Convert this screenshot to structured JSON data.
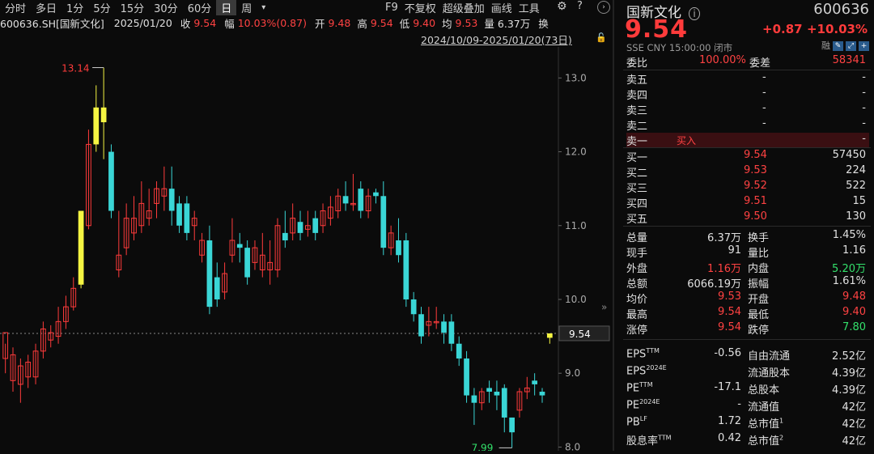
{
  "toolbar": {
    "timeframes": [
      "分时",
      "多日",
      "1分",
      "5分",
      "15分",
      "30分",
      "60分",
      "日",
      "周"
    ],
    "active": "日",
    "dropdown": "▾",
    "tools": [
      "F9",
      "不复权",
      "超级叠加",
      "画线",
      "工具"
    ]
  },
  "info": {
    "ticker": "600636.SH[国新文化]",
    "date": "2025/01/20",
    "close_l": "收",
    "close": "9.54",
    "chg_l": "幅",
    "chg": "10.03%(0.87)",
    "open_l": "开",
    "open": "9.48",
    "high_l": "高",
    "high": "9.54",
    "low_l": "低",
    "low": "9.40",
    "avg_l": "均",
    "avg": "9.53",
    "vol_l": "量",
    "vol": "6.37万",
    "switch": "换"
  },
  "range_label": "2024/10/09-2025/01/20(73日)",
  "chart_data": {
    "type": "candlestick",
    "y_ticks": [
      "13.0",
      "12.0",
      "11.0",
      "10.0",
      "9.0",
      "8.0"
    ],
    "ylim": [
      7.95,
      13.42
    ],
    "current_price": "9.54",
    "max_label": "13.14",
    "min_label": "7.99",
    "candles": [
      [
        9.2,
        9.55,
        9.4,
        9.0
      ],
      [
        8.9,
        9.25,
        9.35,
        8.75
      ],
      [
        8.85,
        9.1,
        9.2,
        8.6
      ],
      [
        8.95,
        9.15,
        9.25,
        8.8
      ],
      [
        8.95,
        9.3,
        9.4,
        8.85
      ],
      [
        9.3,
        9.6,
        9.7,
        9.2
      ],
      [
        9.45,
        9.55,
        9.65,
        9.35
      ],
      [
        9.5,
        9.7,
        9.9,
        9.4
      ],
      [
        9.7,
        9.9,
        10.05,
        9.6
      ],
      [
        9.9,
        10.15,
        10.3,
        9.85
      ],
      [
        10.2,
        11.2,
        11.2,
        10.15
      ],
      [
        11.0,
        12.1,
        12.3,
        10.95
      ],
      [
        12.1,
        12.6,
        12.9,
        12.0
      ],
      [
        12.4,
        12.6,
        13.14,
        11.9
      ],
      [
        12.0,
        11.2,
        12.1,
        11.1
      ],
      [
        10.4,
        10.6,
        11.2,
        10.3
      ],
      [
        10.7,
        11.1,
        11.3,
        10.6
      ],
      [
        10.9,
        11.1,
        11.4,
        10.8
      ],
      [
        11.0,
        11.3,
        11.6,
        10.9
      ],
      [
        11.1,
        11.2,
        11.5,
        11.0
      ],
      [
        11.3,
        11.5,
        11.6,
        11.1
      ],
      [
        11.4,
        11.5,
        11.8,
        11.2
      ],
      [
        11.5,
        11.2,
        11.8,
        11.0
      ],
      [
        11.3,
        11.0,
        11.4,
        10.9
      ],
      [
        11.3,
        10.9,
        11.4,
        10.8
      ],
      [
        11.0,
        11.1,
        11.2,
        10.8
      ],
      [
        10.6,
        10.8,
        10.9,
        10.5
      ],
      [
        10.8,
        9.9,
        11.0,
        9.8
      ],
      [
        10.3,
        10.0,
        10.5,
        9.9
      ],
      [
        10.1,
        10.35,
        10.5,
        10.0
      ],
      [
        10.6,
        10.8,
        11.1,
        10.5
      ],
      [
        10.75,
        10.7,
        10.9,
        10.5
      ],
      [
        10.7,
        10.3,
        10.8,
        10.2
      ],
      [
        10.5,
        10.7,
        10.8,
        10.4
      ],
      [
        10.4,
        10.6,
        10.9,
        10.3
      ],
      [
        10.4,
        10.5,
        10.8,
        10.2
      ],
      [
        10.4,
        11.0,
        11.1,
        10.3
      ],
      [
        10.9,
        10.8,
        11.2,
        10.7
      ],
      [
        10.9,
        11.1,
        11.3,
        10.8
      ],
      [
        11.05,
        10.9,
        11.2,
        10.8
      ],
      [
        10.95,
        11.0,
        11.2,
        10.85
      ],
      [
        11.1,
        10.9,
        11.2,
        10.8
      ],
      [
        11.0,
        11.2,
        11.3,
        10.9
      ],
      [
        11.1,
        11.25,
        11.4,
        11.0
      ],
      [
        11.2,
        11.4,
        11.5,
        11.1
      ],
      [
        11.4,
        11.3,
        11.6,
        11.2
      ],
      [
        11.3,
        11.3,
        11.7,
        11.2
      ],
      [
        11.5,
        11.2,
        11.6,
        11.1
      ],
      [
        11.2,
        11.4,
        11.5,
        11.1
      ],
      [
        11.45,
        11.4,
        11.5,
        11.3
      ],
      [
        11.4,
        10.7,
        11.6,
        10.6
      ],
      [
        10.7,
        10.9,
        11.0,
        10.6
      ],
      [
        10.8,
        10.6,
        11.1,
        10.5
      ],
      [
        10.8,
        10.0,
        10.9,
        9.9
      ],
      [
        10.0,
        9.8,
        10.1,
        9.7
      ],
      [
        9.8,
        9.5,
        9.9,
        9.4
      ],
      [
        9.65,
        9.7,
        9.9,
        9.5
      ],
      [
        9.7,
        9.7,
        9.9,
        9.6
      ],
      [
        9.7,
        9.55,
        9.8,
        9.4
      ],
      [
        9.7,
        9.4,
        9.8,
        9.3
      ],
      [
        9.4,
        9.2,
        9.5,
        9.1
      ],
      [
        9.2,
        8.7,
        9.3,
        8.6
      ],
      [
        8.7,
        8.6,
        8.8,
        8.3
      ],
      [
        8.6,
        8.75,
        8.8,
        8.5
      ],
      [
        8.8,
        8.75,
        8.9,
        8.6
      ],
      [
        8.75,
        8.7,
        8.9,
        8.5
      ],
      [
        8.8,
        8.4,
        8.85,
        8.2
      ],
      [
        8.4,
        8.2,
        8.4,
        7.99
      ],
      [
        8.5,
        8.75,
        8.8,
        8.4
      ],
      [
        8.75,
        8.8,
        8.95,
        8.65
      ],
      [
        8.9,
        8.85,
        9.0,
        8.7
      ],
      [
        8.75,
        8.7,
        8.8,
        8.6
      ],
      [
        9.48,
        9.54,
        9.54,
        9.4
      ]
    ],
    "limit_up_days": [
      10,
      12,
      13,
      72
    ]
  },
  "panel": {
    "name": "国新文化",
    "code": "600636",
    "price": "9.54",
    "change": "+0.87",
    "pct": "+10.03%",
    "sub": "SSE  CNY  15:00:00  闭市",
    "rz": "融",
    "weibi_l": "委比",
    "weibi": "100.00%",
    "weicha_l": "委差",
    "weicha": "58341",
    "sells": [
      {
        "l": "卖五",
        "p": "-",
        "v": "-"
      },
      {
        "l": "卖四",
        "p": "-",
        "v": "-"
      },
      {
        "l": "卖三",
        "p": "-",
        "v": "-"
      },
      {
        "l": "卖二",
        "p": "-",
        "v": "-"
      },
      {
        "l": "卖一",
        "p": "买入",
        "v": "-"
      }
    ],
    "buys": [
      {
        "l": "买一",
        "p": "9.54",
        "v": "57450"
      },
      {
        "l": "买二",
        "p": "9.53",
        "v": "224"
      },
      {
        "l": "买三",
        "p": "9.52",
        "v": "522"
      },
      {
        "l": "买四",
        "p": "9.51",
        "v": "15"
      },
      {
        "l": "买五",
        "p": "9.50",
        "v": "130"
      }
    ],
    "stats": [
      {
        "l1": "总量",
        "v1": "6.37万",
        "c1": "wht",
        "l2": "换手",
        "v2": "1.45%",
        "c2": "wht"
      },
      {
        "l1": "现手",
        "v1": "91",
        "c1": "wht",
        "l2": "量比",
        "v2": "1.16",
        "c2": "wht"
      },
      {
        "l1": "外盘",
        "v1": "1.16万",
        "c1": "red",
        "l2": "内盘",
        "v2": "5.20万",
        "c2": "green"
      },
      {
        "l1": "总额",
        "v1": "6066.19万",
        "c1": "wht",
        "l2": "振幅",
        "v2": "1.61%",
        "c2": "wht"
      },
      {
        "l1": "均价",
        "v1": "9.53",
        "c1": "red",
        "l2": "开盘",
        "v2": "9.48",
        "c2": "red"
      },
      {
        "l1": "最高",
        "v1": "9.54",
        "c1": "red",
        "l2": "最低",
        "v2": "9.40",
        "c2": "red"
      },
      {
        "l1": "涨停",
        "v1": "9.54",
        "c1": "red",
        "l2": "跌停",
        "v2": "7.80",
        "c2": "green"
      }
    ],
    "fin": [
      {
        "l1": "EPS",
        "s1": "TTM",
        "v1": "-0.56",
        "l2": "自由流通",
        "s2": "",
        "v2": "2.52亿"
      },
      {
        "l1": "EPS",
        "s1": "2024E",
        "v1": "",
        "l2": "流通股本",
        "s2": "",
        "v2": "4.39亿"
      },
      {
        "l1": "PE",
        "s1": "TTM",
        "v1": "-17.1",
        "l2": "总股本",
        "s2": "",
        "v2": "4.39亿"
      },
      {
        "l1": "PE",
        "s1": "2024E",
        "v1": "-",
        "l2": "流通值",
        "s2": "",
        "v2": "42亿"
      },
      {
        "l1": "PB",
        "s1": "LF",
        "v1": "1.72",
        "l2": "总市值",
        "s2": "1",
        "v2": "42亿"
      },
      {
        "l1": "股息率",
        "s1": "TTM",
        "v1": "0.42",
        "l2": "总市值",
        "s2": "2",
        "v2": "42亿"
      }
    ],
    "colors": {
      "up": "#ff3b3b",
      "down": "#3ad6d6",
      "limit": "#f5f542",
      "bg": "#0b0b0b"
    }
  }
}
